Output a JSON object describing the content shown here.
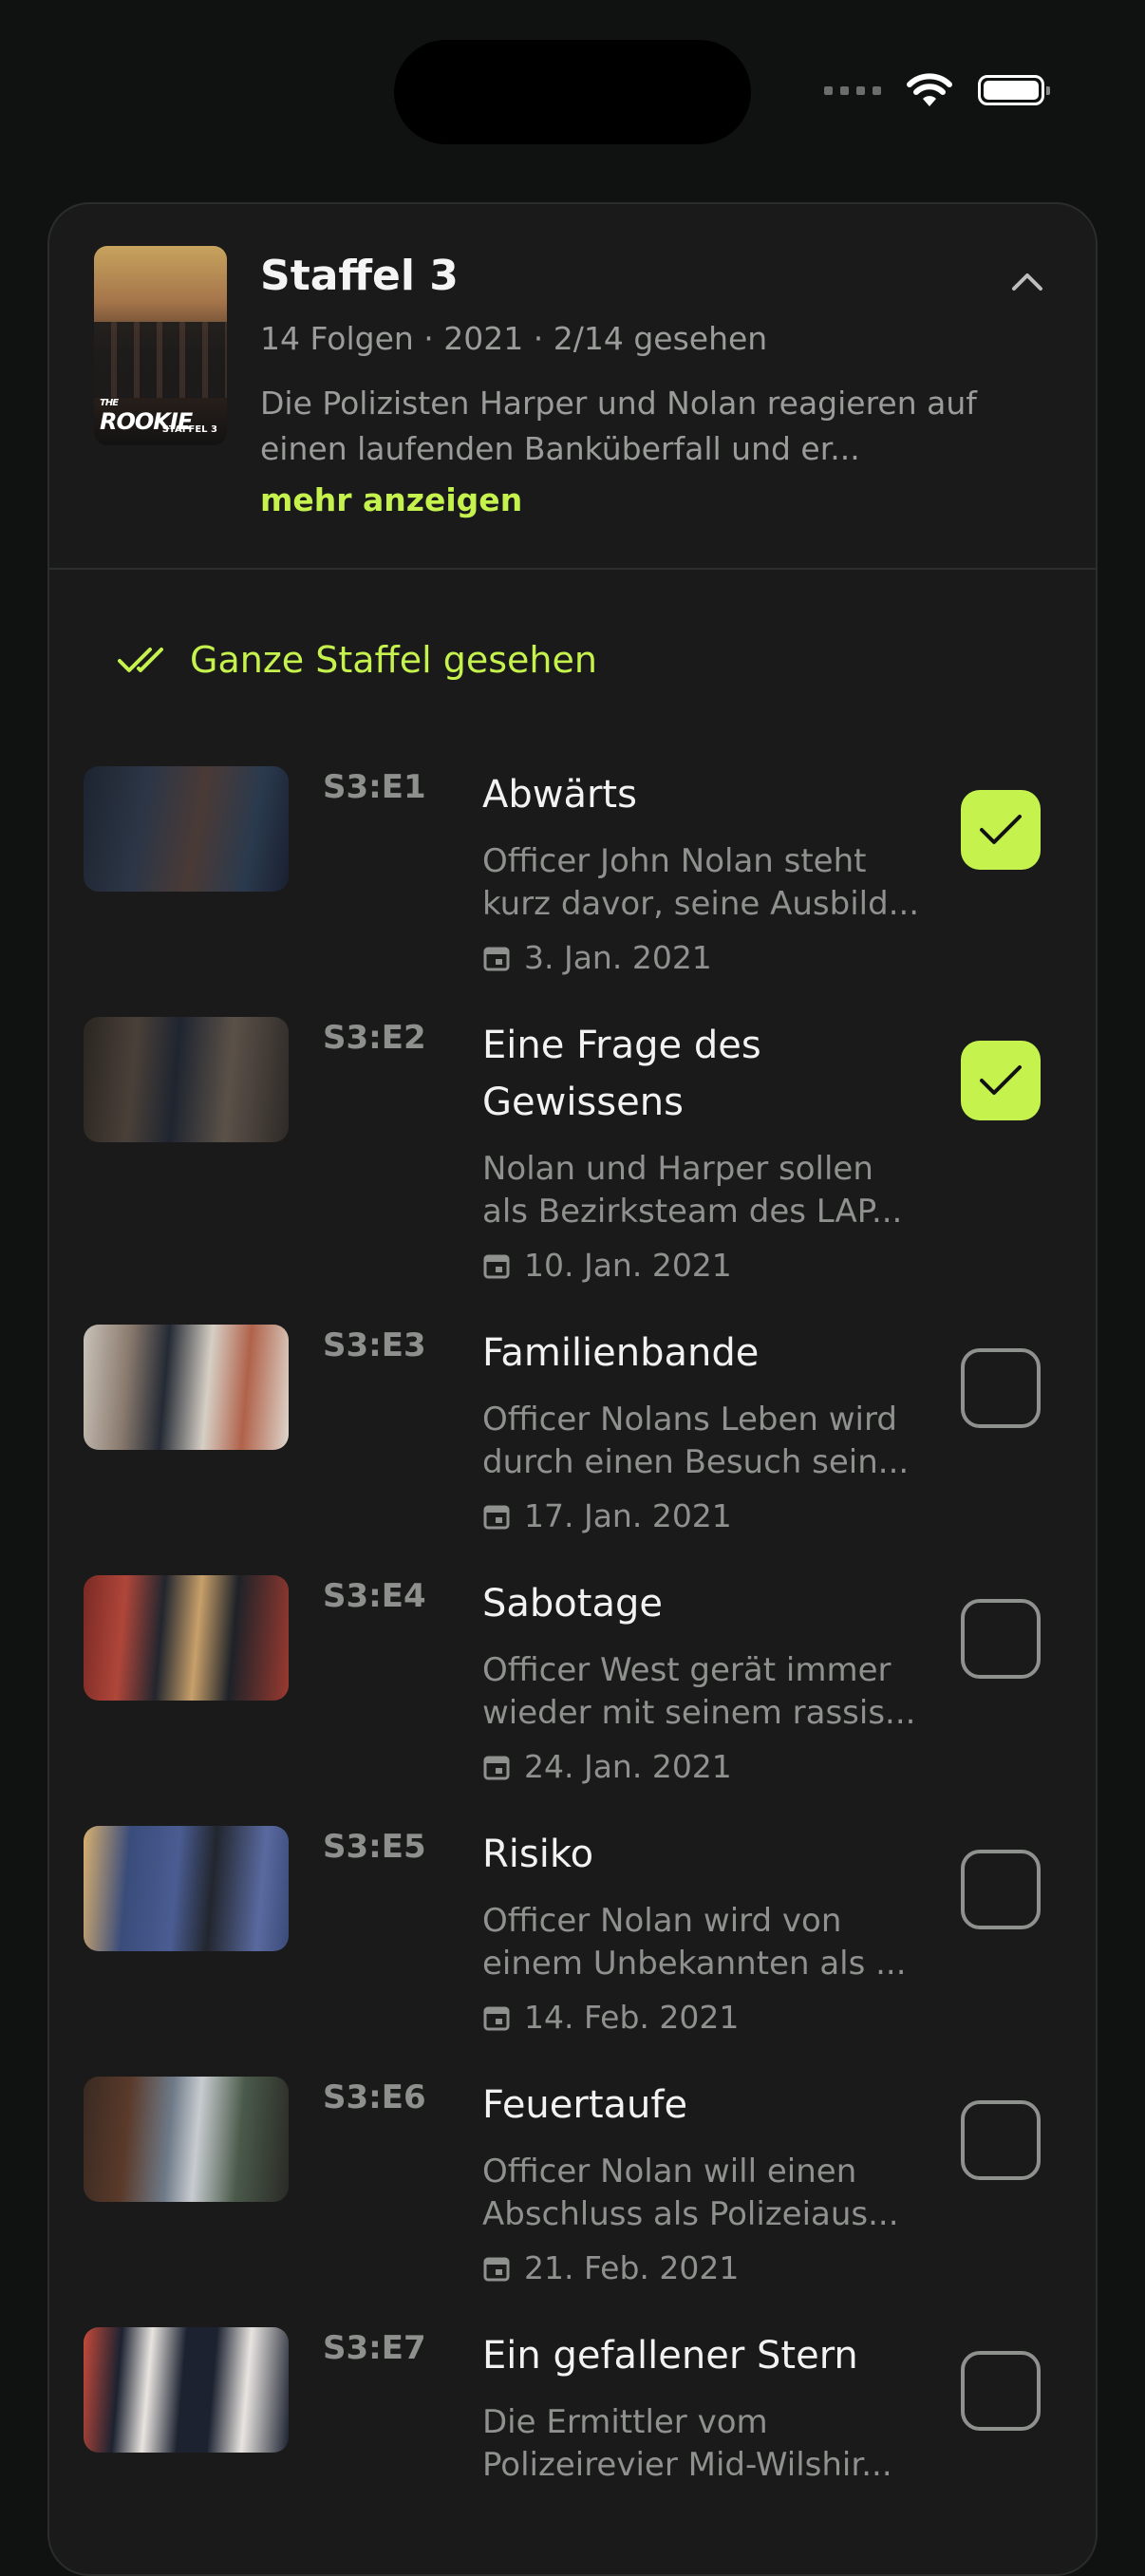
{
  "season": {
    "title": "Staffel 3",
    "meta": "14 Folgen · 2021 · 2/14 gesehen",
    "description": "Die Polizisten Harper und Nolan reagieren auf einen laufenden Banküberfall und er...",
    "more_label": "mehr anzeigen",
    "poster_title": "ROOKIE",
    "poster_pre": "THE",
    "poster_sub": "STAFFEL 3"
  },
  "mark_all_label": "Ganze Staffel gesehen",
  "accent_color": "#c6f24e",
  "episodes": [
    {
      "code": "S3:E1",
      "title": "Abwärts",
      "desc1": "Officer John Nolan steht",
      "desc2": "kurz davor, seine Ausbild...",
      "date": "3. Jan. 2021",
      "watched": true
    },
    {
      "code": "S3:E2",
      "title": "Eine Frage des Gewissens",
      "desc1": "Nolan und Harper sollen",
      "desc2": "als Bezirksteam des LAP...",
      "date": "10. Jan. 2021",
      "watched": true
    },
    {
      "code": "S3:E3",
      "title": "Familienbande",
      "desc1": "Officer Nolans Leben wird",
      "desc2": "durch einen Besuch sein...",
      "date": "17. Jan. 2021",
      "watched": false
    },
    {
      "code": "S3:E4",
      "title": "Sabotage",
      "desc1": "Officer West gerät immer",
      "desc2": "wieder mit seinem rassis...",
      "date": "24. Jan. 2021",
      "watched": false
    },
    {
      "code": "S3:E5",
      "title": "Risiko",
      "desc1": "Officer Nolan wird von",
      "desc2": "einem Unbekannten als ...",
      "date": "14. Feb. 2021",
      "watched": false
    },
    {
      "code": "S3:E6",
      "title": "Feuertaufe",
      "desc1": "Officer Nolan will einen",
      "desc2": "Abschluss als Polizeiaus...",
      "date": "21. Feb. 2021",
      "watched": false
    },
    {
      "code": "S3:E7",
      "title": "Ein gefallener Stern",
      "desc1": "Die Ermittler vom",
      "desc2": "Polizeirevier Mid-Wilshir...",
      "date": "",
      "watched": false
    }
  ]
}
